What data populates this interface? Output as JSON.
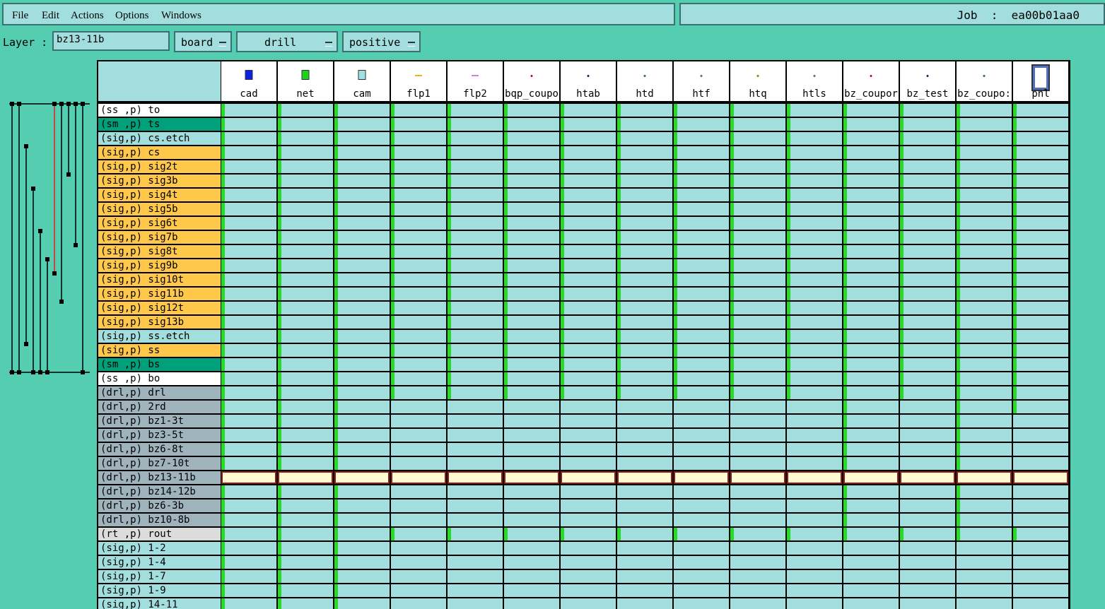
{
  "menu": {
    "file": "File",
    "edit": "Edit",
    "actions": "Actions",
    "options": "Options",
    "windows": "Windows"
  },
  "job": {
    "text": "Job  :  ea00b01aa0"
  },
  "layer": {
    "label": "Layer  :",
    "value": "bz13-11b",
    "context": "board",
    "type": "drill",
    "polarity": "positive"
  },
  "steps": [
    {
      "name": "cad",
      "icon": "blue-step-icon",
      "color": "#1020e0"
    },
    {
      "name": "net",
      "icon": "green-step-icon",
      "color": "#20d020"
    },
    {
      "name": "cam",
      "icon": "cyan-step-icon",
      "color": "#a0e0e0"
    },
    {
      "name": "flp1",
      "icon": "orange-dash-icon",
      "color": "#f0b020"
    },
    {
      "name": "flp2",
      "icon": "purple-dash-icon",
      "color": "#d080e0"
    },
    {
      "name": "bqp_coupo",
      "icon": "dot-icon",
      "color": "#b01010"
    },
    {
      "name": "htab",
      "icon": "dot-icon",
      "color": "#101080"
    },
    {
      "name": "htd",
      "icon": "dot-icon",
      "color": "#108010"
    },
    {
      "name": "htf",
      "icon": "dot-icon",
      "color": "#606060"
    },
    {
      "name": "htq",
      "icon": "dot-icon",
      "color": "#808000"
    },
    {
      "name": "htls",
      "icon": "dot-icon",
      "color": "#606060"
    },
    {
      "name": "bz_coupor",
      "icon": "dot-icon",
      "color": "#b01010"
    },
    {
      "name": "bz_test",
      "icon": "dot-icon",
      "color": "#101080"
    },
    {
      "name": "bz_coupo:",
      "icon": "dot-icon",
      "color": "#108010"
    },
    {
      "name": "pnl",
      "icon": "panel-icon",
      "color": "#5070c0"
    }
  ],
  "layers": [
    {
      "name": "(ss ,p) to",
      "color": "#ffffff"
    },
    {
      "name": "(sm ,p) ts",
      "color": "#00a07a"
    },
    {
      "name": "(sig,p) cs.etch",
      "color": "#a3dede"
    },
    {
      "name": "(sig,p) cs",
      "color": "#ffc84a"
    },
    {
      "name": "(sig,p) sig2t",
      "color": "#ffc84a"
    },
    {
      "name": "(sig,p) sig3b",
      "color": "#ffc84a"
    },
    {
      "name": "(sig,p) sig4t",
      "color": "#ffc84a"
    },
    {
      "name": "(sig,p) sig5b",
      "color": "#ffc84a"
    },
    {
      "name": "(sig,p) sig6t",
      "color": "#ffc84a"
    },
    {
      "name": "(sig,p) sig7b",
      "color": "#ffc84a"
    },
    {
      "name": "(sig,p) sig8t",
      "color": "#ffc84a"
    },
    {
      "name": "(sig,p) sig9b",
      "color": "#ffc84a"
    },
    {
      "name": "(sig,p) sig10t",
      "color": "#ffc84a"
    },
    {
      "name": "(sig,p) sig11b",
      "color": "#ffc84a"
    },
    {
      "name": "(sig,p) sig12t",
      "color": "#ffc84a"
    },
    {
      "name": "(sig,p) sig13b",
      "color": "#ffc84a"
    },
    {
      "name": "(sig,p) ss.etch",
      "color": "#a3dede"
    },
    {
      "name": "(sig,p) ss",
      "color": "#ffc84a"
    },
    {
      "name": "(sm ,p) bs",
      "color": "#00a07a"
    },
    {
      "name": "(ss ,p) bo",
      "color": "#ffffff"
    },
    {
      "name": "(drl,p) drl",
      "color": "#9fb3bd"
    },
    {
      "name": "(drl,p) 2rd",
      "color": "#9fb3bd"
    },
    {
      "name": "(drl,p) bz1-3t",
      "color": "#9fb3bd"
    },
    {
      "name": "(drl,p) bz3-5t",
      "color": "#9fb3bd"
    },
    {
      "name": "(drl,p) bz6-8t",
      "color": "#9fb3bd"
    },
    {
      "name": "(drl,p) bz7-10t",
      "color": "#9fb3bd"
    },
    {
      "name": "(drl,p) bz13-11b",
      "color": "#9fb3bd"
    },
    {
      "name": "(drl,p) bz14-12b",
      "color": "#9fb3bd"
    },
    {
      "name": "(drl,p) bz6-3b",
      "color": "#9fb3bd"
    },
    {
      "name": "(drl,p) bz10-8b",
      "color": "#9fb3bd"
    },
    {
      "name": "(rt ,p) rout",
      "color": "#dcdcdc"
    },
    {
      "name": "(sig,p) 1-2",
      "color": "#a3dede"
    },
    {
      "name": "(sig,p) 1-4",
      "color": "#a3dede"
    },
    {
      "name": "(sig,p) 1-7",
      "color": "#a3dede"
    },
    {
      "name": "(sig,p) 1-9",
      "color": "#a3dede"
    },
    {
      "name": "(sig,p) 14-11",
      "color": "#a3dede"
    }
  ],
  "selected_layer": "(drl,p) bz13-11b"
}
